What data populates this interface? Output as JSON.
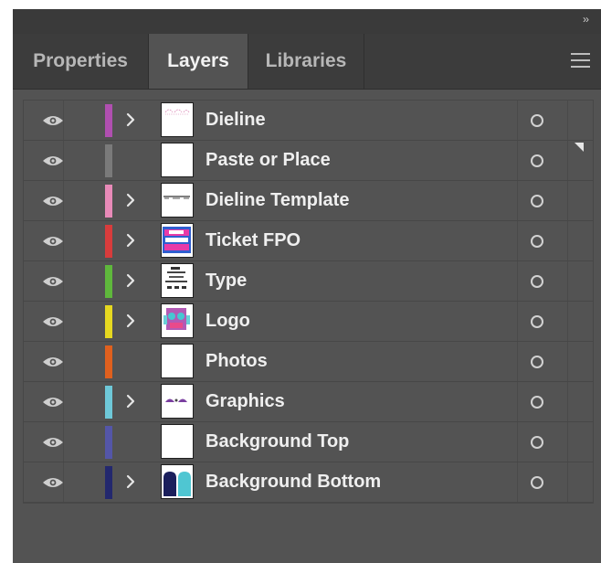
{
  "panel": {
    "collapse_glyph": "››",
    "tabs": [
      {
        "label": "Properties",
        "active": false
      },
      {
        "label": "Layers",
        "active": true
      },
      {
        "label": "Libraries",
        "active": false
      }
    ],
    "menu_icon": "hamburger-menu-icon"
  },
  "layers": [
    {
      "name": "Dieline",
      "color": "#b04fb0",
      "expandable": true,
      "thumb": "dieline"
    },
    {
      "name": "Paste or Place",
      "color": "#7a7a7a",
      "expandable": false,
      "thumb": "blank"
    },
    {
      "name": "Dieline Template",
      "color": "#e88ab8",
      "expandable": true,
      "thumb": "template"
    },
    {
      "name": "Ticket FPO",
      "color": "#d83c3c",
      "expandable": true,
      "thumb": "ticket"
    },
    {
      "name": "Type",
      "color": "#5fb83c",
      "expandable": true,
      "thumb": "type"
    },
    {
      "name": "Logo",
      "color": "#e6d820",
      "expandable": true,
      "thumb": "logo"
    },
    {
      "name": "Photos",
      "color": "#e0601e",
      "expandable": false,
      "thumb": "blank"
    },
    {
      "name": "Graphics",
      "color": "#6ec8d8",
      "expandable": true,
      "thumb": "graphics"
    },
    {
      "name": "Background Top",
      "color": "#5456a8",
      "expandable": false,
      "thumb": "blank"
    },
    {
      "name": "Background Bottom",
      "color": "#23286e",
      "expandable": true,
      "thumb": "bgbottom"
    }
  ],
  "colors": {
    "panel_bg": "#535353",
    "tab_bar_bg": "#3c3c3c",
    "text": "#efefef"
  }
}
